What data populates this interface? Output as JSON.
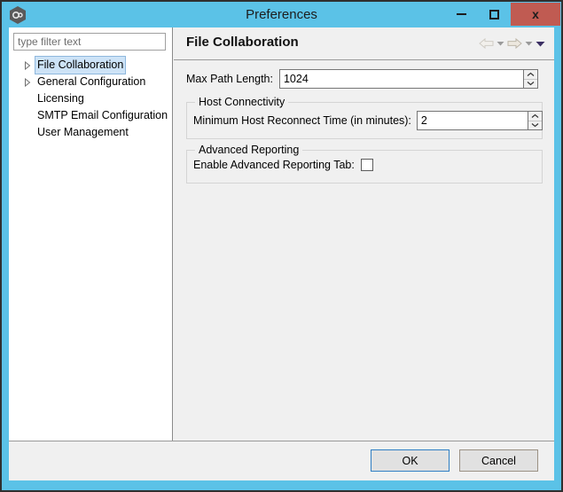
{
  "window": {
    "title": "Preferences",
    "icon": "app-hexagon-icon",
    "frame_color": "#5BC2E7",
    "controls": {
      "minimize": "–",
      "maximize": "□",
      "close": "x",
      "close_bg": "#C05B52"
    }
  },
  "sidebar": {
    "filter": {
      "value": "",
      "placeholder": "type filter text"
    },
    "items": [
      {
        "label": "File Collaboration",
        "expandable": true,
        "selected": true
      },
      {
        "label": "General Configuration",
        "expandable": true,
        "selected": false
      },
      {
        "label": "Licensing",
        "expandable": false,
        "selected": false
      },
      {
        "label": "SMTP Email Configuration",
        "expandable": false,
        "selected": false
      },
      {
        "label": "User Management",
        "expandable": false,
        "selected": false
      }
    ]
  },
  "main": {
    "title": "File Collaboration",
    "nav": {
      "back": "back-arrow-icon",
      "back_menu": "chevron-down-icon",
      "forward": "forward-arrow-icon",
      "forward_menu": "chevron-down-icon",
      "more_menu": "chevron-down-icon"
    },
    "fields": {
      "max_path_length": {
        "label": "Max Path Length:",
        "value": "1024"
      }
    },
    "groups": [
      {
        "title": "Host Connectivity",
        "field": {
          "label": "Minimum Host Reconnect Time (in minutes):",
          "value": "2"
        }
      },
      {
        "title": "Advanced Reporting",
        "checkbox": {
          "label": "Enable Advanced Reporting Tab:",
          "checked": false
        }
      }
    ]
  },
  "footer": {
    "ok_label": "OK",
    "cancel_label": "Cancel"
  }
}
